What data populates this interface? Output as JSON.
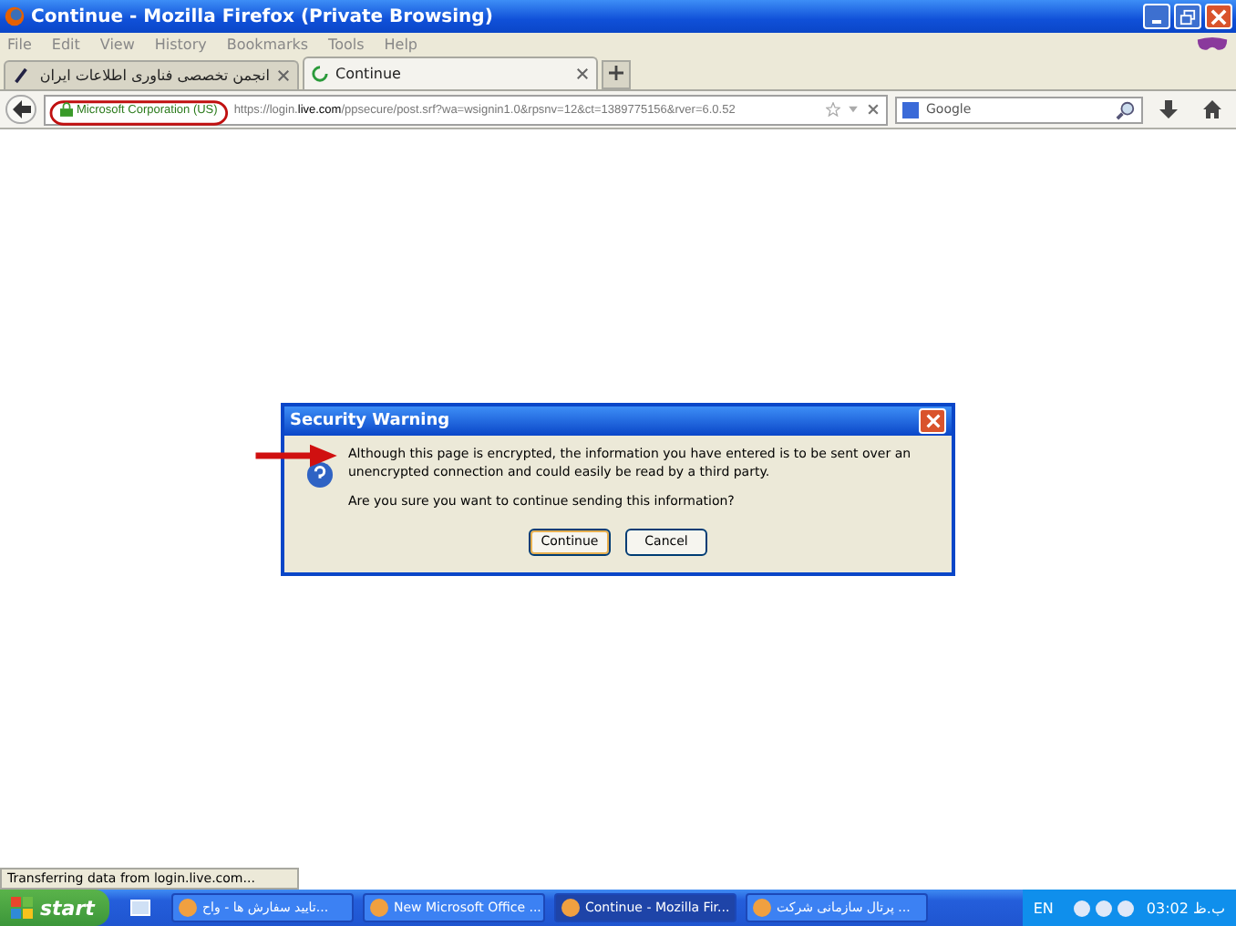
{
  "window": {
    "title": "Continue - Mozilla Firefox (Private Browsing)"
  },
  "menu": [
    "File",
    "Edit",
    "View",
    "History",
    "Bookmarks",
    "Tools",
    "Help"
  ],
  "tabs": [
    {
      "label": "انجمن تخصصی فناوری اطلاعات ایران",
      "selected": false
    },
    {
      "label": "Continue",
      "selected": true
    }
  ],
  "navbar": {
    "identity": "Microsoft Corporation (US)",
    "url_prefix": "https://login.",
    "url_domain": "live.com",
    "url_rest": "/ppsecure/post.srf?wa=wsignin1.0&rpsnv=12&ct=1389775156&rver=6.0.52",
    "search_placeholder": "Google"
  },
  "dialog": {
    "title": "Security Warning",
    "message": "Although this page is encrypted, the information you have entered is to be sent over an unencrypted connection and could easily be read by a third party.",
    "question": "Are you sure you want to continue sending this information?",
    "buttons": [
      {
        "label": "Continue",
        "selected": true
      },
      {
        "label": "Cancel",
        "selected": false
      }
    ]
  },
  "status_bar": "Transferring data from login.live.com...",
  "taskbar": {
    "start": "start",
    "items": [
      {
        "label": "تایید سفارش ها - واح...",
        "selected": false
      },
      {
        "label": "New Microsoft Office ...",
        "selected": false
      },
      {
        "label": "Continue - Mozilla Fir...",
        "selected": true
      },
      {
        "label": "پرتال سازمانی شرکت ...",
        "selected": false
      }
    ],
    "language": "EN",
    "clock": "03:02 ب.ظ"
  }
}
